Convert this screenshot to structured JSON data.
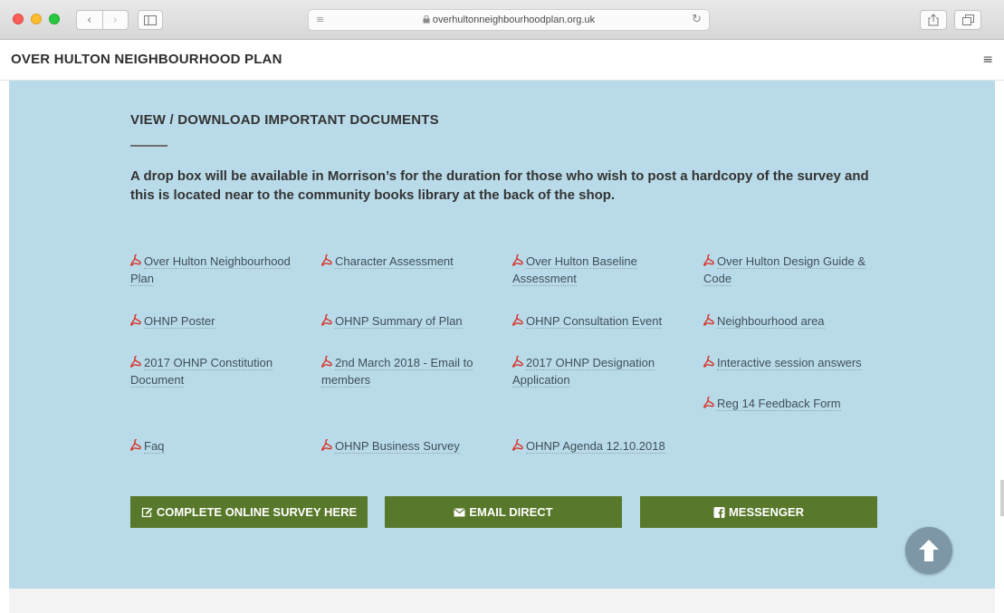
{
  "browser": {
    "url": "overhultonneighbourhoodplan.org.uk"
  },
  "site": {
    "title": "OVER HULTON NEIGHBOURHOOD PLAN"
  },
  "section": {
    "heading": "VIEW / DOWNLOAD IMPORTANT DOCUMENTS",
    "intro": "A drop box will be available in Morrison’s for the duration for those who wish to post a hardcopy of the survey and this is located near to the community books library at the back of the shop."
  },
  "documents": [
    {
      "label": "Over Hulton Neighbourhood Plan"
    },
    {
      "label": "Character Assessment"
    },
    {
      "label": "Over Hulton Baseline Assessment"
    },
    {
      "label": "Over Hulton Design Guide & Code"
    },
    {
      "label": "OHNP Poster"
    },
    {
      "label": "OHNP Summary of Plan"
    },
    {
      "label": "OHNP Consultation Event"
    },
    {
      "label": "Neighbourhood area"
    },
    {
      "label": "2017 OHNP Constitution Document"
    },
    {
      "label": "2nd March 2018 - Email to members"
    },
    {
      "label": "2017 OHNP Designation Application"
    },
    {
      "label": "Interactive session answers"
    },
    {
      "label": "Reg 14 Feedback Form"
    },
    {
      "label": "Faq"
    },
    {
      "label": "OHNP Business Survey"
    },
    {
      "label": "OHNP Agenda 12.10.2018"
    }
  ],
  "actions": {
    "survey_label": "COMPLETE ONLINE SURVEY HERE",
    "email_label": "EMAIL DIRECT",
    "messenger_label": "MESSENGER"
  },
  "icons": {
    "document": "pdf-icon",
    "survey": "edit-icon",
    "email": "envelope-icon",
    "messenger": "facebook-icon",
    "back_to_top": "arrow-up-icon"
  },
  "colors": {
    "content_background": "#b9dbe9",
    "button_green": "#58792b",
    "pdf_red": "#d8342b"
  }
}
